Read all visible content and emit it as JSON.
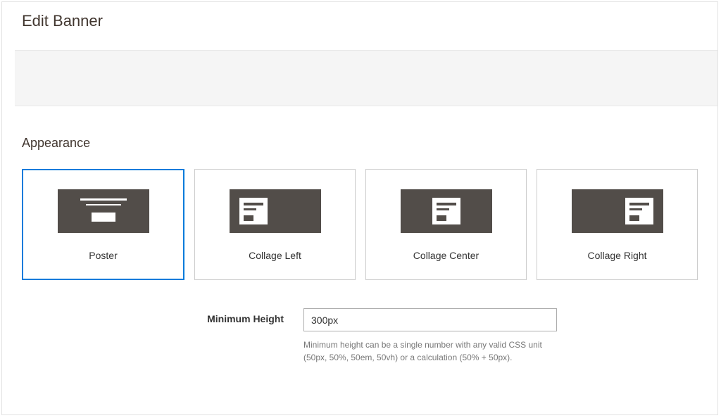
{
  "page": {
    "title": "Edit Banner"
  },
  "appearance": {
    "title": "Appearance",
    "options": [
      {
        "label": "Poster",
        "selected": true
      },
      {
        "label": "Collage Left",
        "selected": false
      },
      {
        "label": "Collage Center",
        "selected": false
      },
      {
        "label": "Collage Right",
        "selected": false
      }
    ]
  },
  "form": {
    "min_height": {
      "label": "Minimum Height",
      "value": "300px",
      "help": "Minimum height can be a single number with any valid CSS unit (50px, 50%, 50em, 50vh) or a calculation (50% + 50px)."
    }
  }
}
